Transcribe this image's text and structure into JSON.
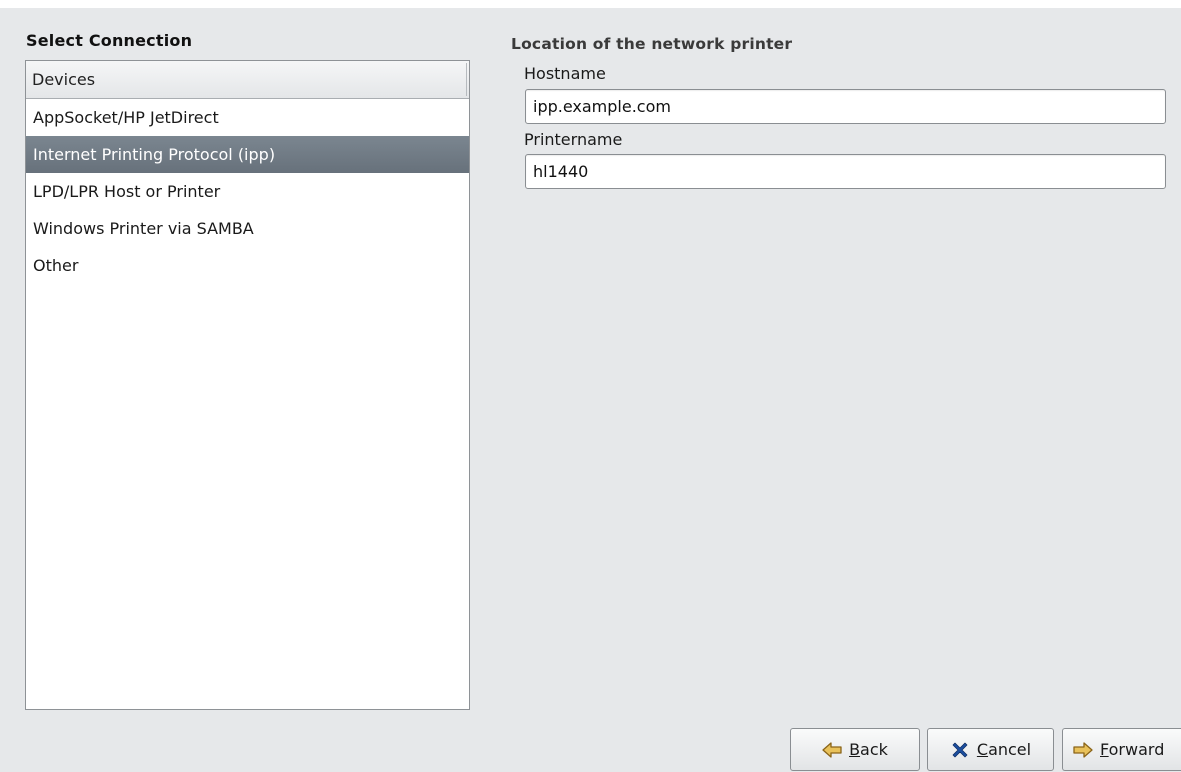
{
  "select_connection": {
    "title": "Select Connection",
    "list_header": "Devices",
    "items": [
      {
        "label": "AppSocket/HP JetDirect",
        "selected": false
      },
      {
        "label": "Internet Printing Protocol (ipp)",
        "selected": true
      },
      {
        "label": "LPD/LPR Host or Printer",
        "selected": false
      },
      {
        "label": "Windows Printer via SAMBA",
        "selected": false
      },
      {
        "label": "Other",
        "selected": false
      }
    ]
  },
  "location": {
    "title": "Location of the network printer",
    "hostname_label": "Hostname",
    "hostname_value": "ipp.example.com",
    "printername_label": "Printername",
    "printername_value": "hl1440"
  },
  "buttons": {
    "back": {
      "mnemonic": "B",
      "rest": "ack",
      "icon": "arrow-left-icon"
    },
    "cancel": {
      "mnemonic": "C",
      "rest": "ancel",
      "icon": "x-cancel-icon"
    },
    "forward": {
      "mnemonic": "F",
      "rest": "orward",
      "icon": "arrow-right-icon"
    }
  },
  "colors": {
    "selection": "#6e7882",
    "cancel_icon": "#1c4fa0",
    "arrow_icon": "#c08a28"
  }
}
